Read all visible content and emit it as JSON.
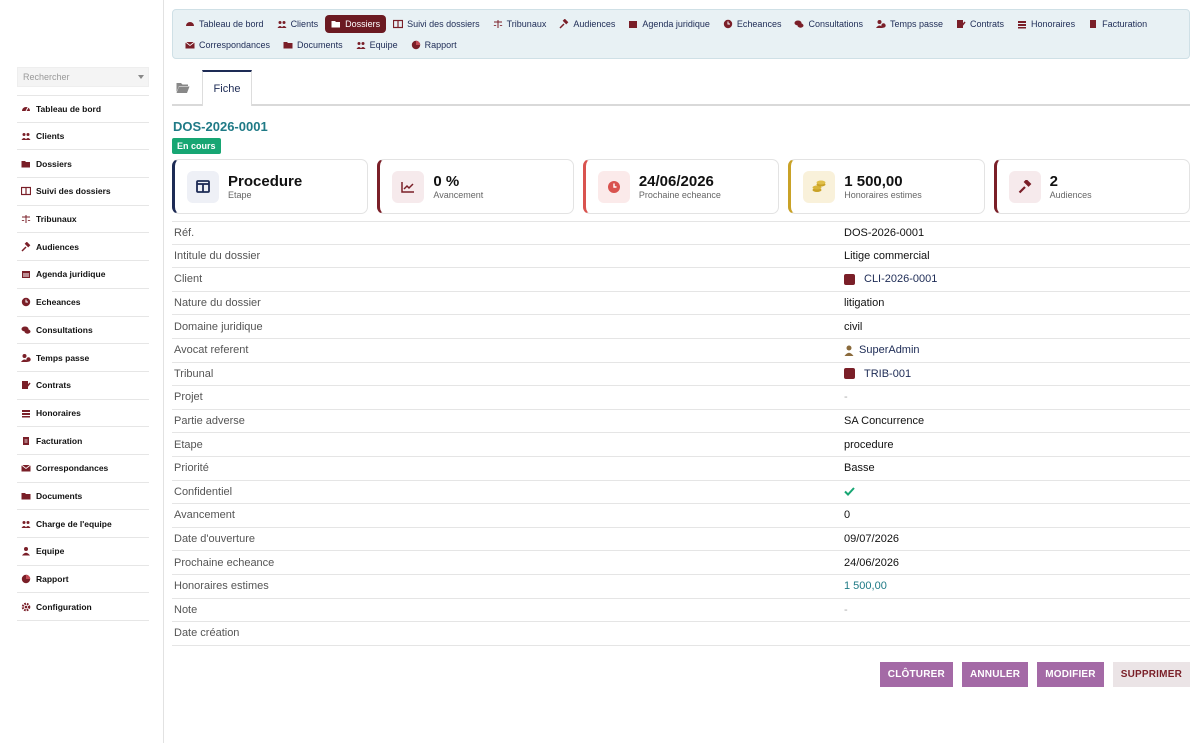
{
  "sidebar": {
    "search_placeholder": "Rechercher",
    "items": [
      {
        "label": "Tableau de bord",
        "icon": "dashboard-icon"
      },
      {
        "label": "Clients",
        "icon": "users-icon"
      },
      {
        "label": "Dossiers",
        "icon": "folder-open-icon"
      },
      {
        "label": "Suivi des dossiers",
        "icon": "columns-icon"
      },
      {
        "label": "Tribunaux",
        "icon": "balance-scale-icon"
      },
      {
        "label": "Audiences",
        "icon": "gavel-icon"
      },
      {
        "label": "Agenda juridique",
        "icon": "calendar-icon"
      },
      {
        "label": "Echeances",
        "icon": "clock-icon"
      },
      {
        "label": "Consultations",
        "icon": "comments-icon"
      },
      {
        "label": "Temps passe",
        "icon": "user-clock-icon"
      },
      {
        "label": "Contrats",
        "icon": "contract-icon"
      },
      {
        "label": "Honoraires",
        "icon": "money-stack-icon"
      },
      {
        "label": "Facturation",
        "icon": "invoice-icon"
      },
      {
        "label": "Correspondances",
        "icon": "envelope-icon"
      },
      {
        "label": "Documents",
        "icon": "folder-icon"
      },
      {
        "label": "Charge de l'equipe",
        "icon": "team-load-icon"
      },
      {
        "label": "Equipe",
        "icon": "user-icon"
      },
      {
        "label": "Rapport",
        "icon": "pie-chart-icon"
      },
      {
        "label": "Configuration",
        "icon": "gear-icon"
      }
    ]
  },
  "topmenu": {
    "items": [
      {
        "label": "Tableau de bord",
        "active": false
      },
      {
        "label": "Clients",
        "active": false
      },
      {
        "label": "Dossiers",
        "active": true
      },
      {
        "label": "Suivi des dossiers",
        "active": false
      },
      {
        "label": "Tribunaux",
        "active": false
      },
      {
        "label": "Audiences",
        "active": false
      },
      {
        "label": "Agenda juridique",
        "active": false
      },
      {
        "label": "Echeances",
        "active": false
      },
      {
        "label": "Consultations",
        "active": false
      },
      {
        "label": "Temps passe",
        "active": false
      },
      {
        "label": "Contrats",
        "active": false
      },
      {
        "label": "Honoraires",
        "active": false
      },
      {
        "label": "Facturation",
        "active": false
      },
      {
        "label": "Correspondances",
        "active": false
      },
      {
        "label": "Documents",
        "active": false
      },
      {
        "label": "Equipe",
        "active": false
      },
      {
        "label": "Rapport",
        "active": false
      }
    ]
  },
  "tabs": {
    "fiche": "Fiche"
  },
  "dossier": {
    "ref": "DOS-2026-0001",
    "status": "En cours"
  },
  "kpis": [
    {
      "value": "Procedure",
      "label": "Etape",
      "color": "#1d2b55"
    },
    {
      "value": "0 %",
      "label": "Avancement",
      "color": "#7a1f28"
    },
    {
      "value": "24/06/2026",
      "label": "Prochaine echeance",
      "color": "#d9534f"
    },
    {
      "value": "1 500,00",
      "label": "Honoraires estimes",
      "color": "#c9a227"
    },
    {
      "value": "2",
      "label": "Audiences",
      "color": "#7a1f28"
    }
  ],
  "details": [
    {
      "label": "Réf.",
      "value": "DOS-2026-0001"
    },
    {
      "label": "Intitule du dossier",
      "value": "Litige commercial"
    },
    {
      "label": "Client",
      "value": "CLI-2026-0001"
    },
    {
      "label": "Nature du dossier",
      "value": "litigation"
    },
    {
      "label": "Domaine juridique",
      "value": "civil"
    },
    {
      "label": "Avocat referent",
      "value": "SuperAdmin"
    },
    {
      "label": "Tribunal",
      "value": "TRIB-001"
    },
    {
      "label": "Projet",
      "value": "-"
    },
    {
      "label": "Partie adverse",
      "value": "SA Concurrence"
    },
    {
      "label": "Etape",
      "value": "procedure"
    },
    {
      "label": "Priorité",
      "value": "Basse"
    },
    {
      "label": "Confidentiel",
      "value": ""
    },
    {
      "label": "Avancement",
      "value": "0"
    },
    {
      "label": "Date d'ouverture",
      "value": "09/07/2026"
    },
    {
      "label": "Prochaine echeance",
      "value": "24/06/2026"
    },
    {
      "label": "Honoraires estimes",
      "value": "1 500,00"
    },
    {
      "label": "Note",
      "value": "-"
    },
    {
      "label": "Date création",
      "value": ""
    }
  ],
  "actions": {
    "close": "CLÔTURER",
    "cancel": "ANNULER",
    "edit": "MODIFIER",
    "delete": "SUPPRIMER"
  },
  "colors": {
    "primary": "#1d2b55",
    "accent": "#6b1a21",
    "teal": "#1f7a86",
    "success": "#17a673"
  }
}
